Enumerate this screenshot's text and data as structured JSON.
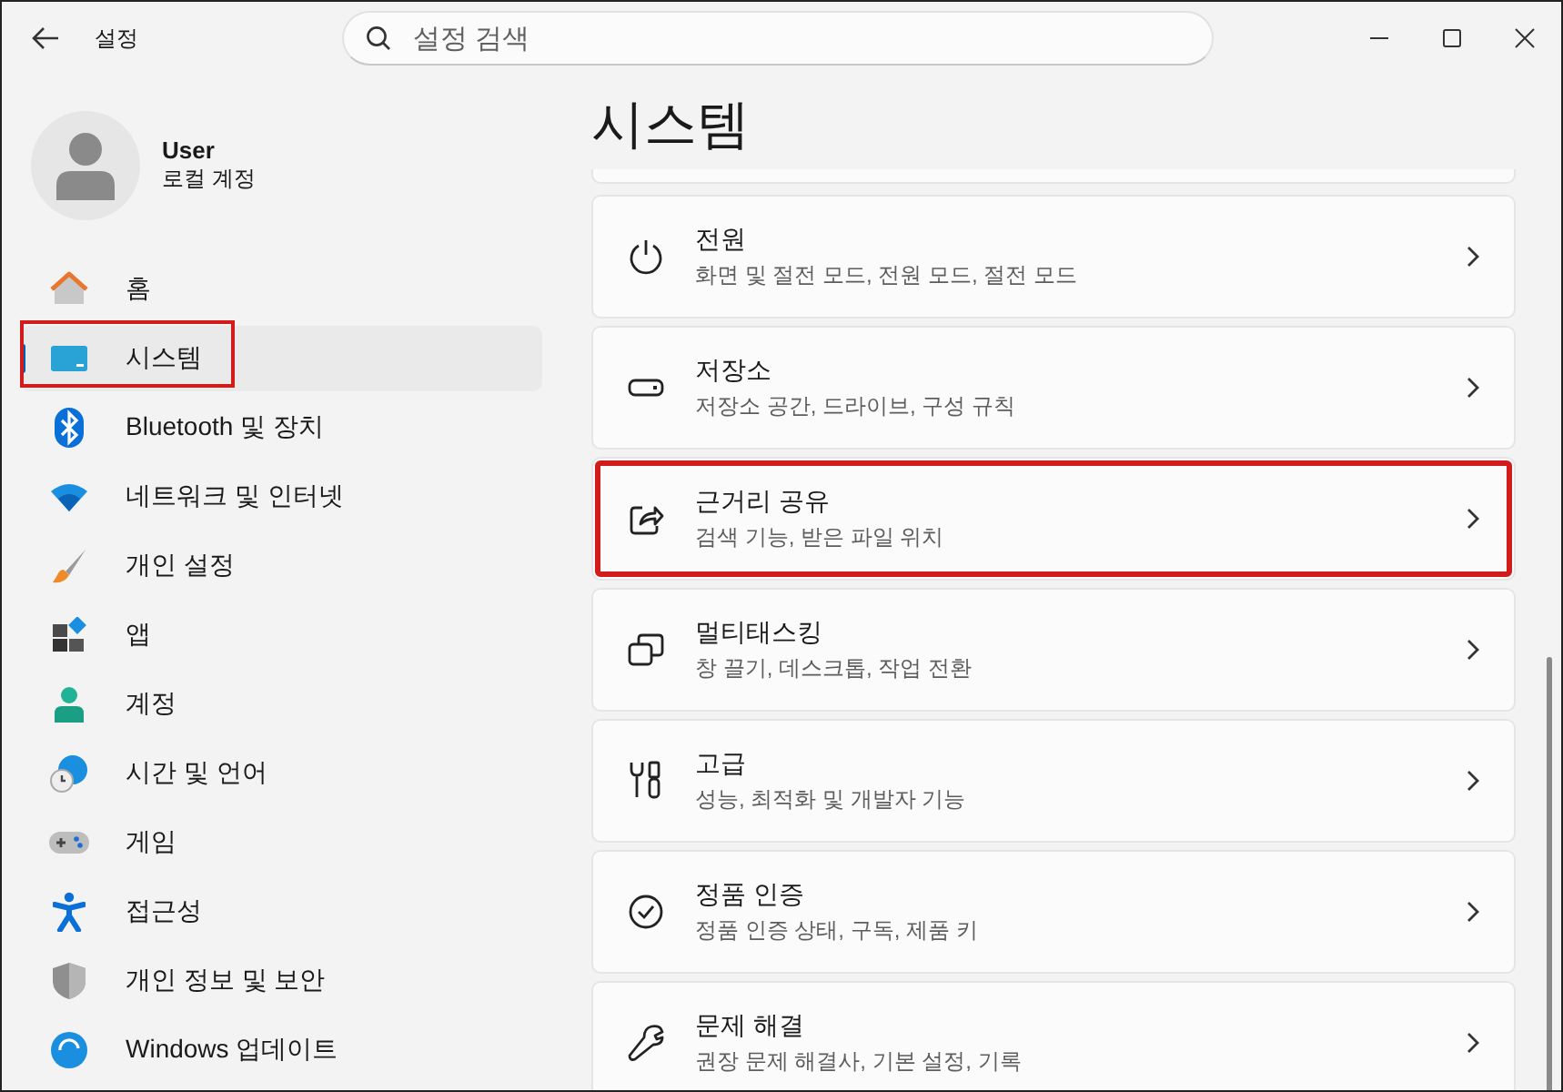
{
  "window": {
    "title": "설정",
    "search_placeholder": "설정 검색"
  },
  "user": {
    "name": "User",
    "account": "로컬 계정"
  },
  "sidebar": {
    "items": [
      {
        "label": "홈",
        "kind": "home",
        "selected": false,
        "highlighted": false
      },
      {
        "label": "시스템",
        "kind": "system",
        "selected": true,
        "highlighted": true
      },
      {
        "label": "Bluetooth 및 장치",
        "kind": "bluetooth",
        "selected": false,
        "highlighted": false
      },
      {
        "label": "네트워크 및 인터넷",
        "kind": "wifi",
        "selected": false,
        "highlighted": false
      },
      {
        "label": "개인 설정",
        "kind": "brush",
        "selected": false,
        "highlighted": false
      },
      {
        "label": "앱",
        "kind": "apps",
        "selected": false,
        "highlighted": false
      },
      {
        "label": "계정",
        "kind": "person",
        "selected": false,
        "highlighted": false
      },
      {
        "label": "시간 및 언어",
        "kind": "globe",
        "selected": false,
        "highlighted": false
      },
      {
        "label": "게임",
        "kind": "gamepad",
        "selected": false,
        "highlighted": false
      },
      {
        "label": "접근성",
        "kind": "accessibility",
        "selected": false,
        "highlighted": false
      },
      {
        "label": "개인 정보 및 보안",
        "kind": "shield",
        "selected": false,
        "highlighted": false
      },
      {
        "label": "Windows 업데이트",
        "kind": "update",
        "selected": false,
        "highlighted": false
      }
    ]
  },
  "page": {
    "title": "시스템",
    "cards": [
      {
        "title": "전원",
        "subtitle": "화면 및 절전 모드, 전원 모드, 절전 모드",
        "kind": "power",
        "highlighted": false
      },
      {
        "title": "저장소",
        "subtitle": "저장소 공간, 드라이브, 구성 규칙",
        "kind": "storage",
        "highlighted": false
      },
      {
        "title": "근거리 공유",
        "subtitle": "검색 기능, 받은 파일 위치",
        "kind": "share",
        "highlighted": true
      },
      {
        "title": "멀티태스킹",
        "subtitle": "창 끌기, 데스크톱, 작업 전환",
        "kind": "multitask",
        "highlighted": false
      },
      {
        "title": "고급",
        "subtitle": "성능, 최적화 및 개발자 기능",
        "kind": "tools",
        "highlighted": false
      },
      {
        "title": "정품 인증",
        "subtitle": "정품 인증 상태, 구독, 제품 키",
        "kind": "check",
        "highlighted": false
      },
      {
        "title": "문제 해결",
        "subtitle": "권장 문제 해결사, 기본 설정, 기록",
        "kind": "wrench",
        "highlighted": false
      }
    ]
  }
}
